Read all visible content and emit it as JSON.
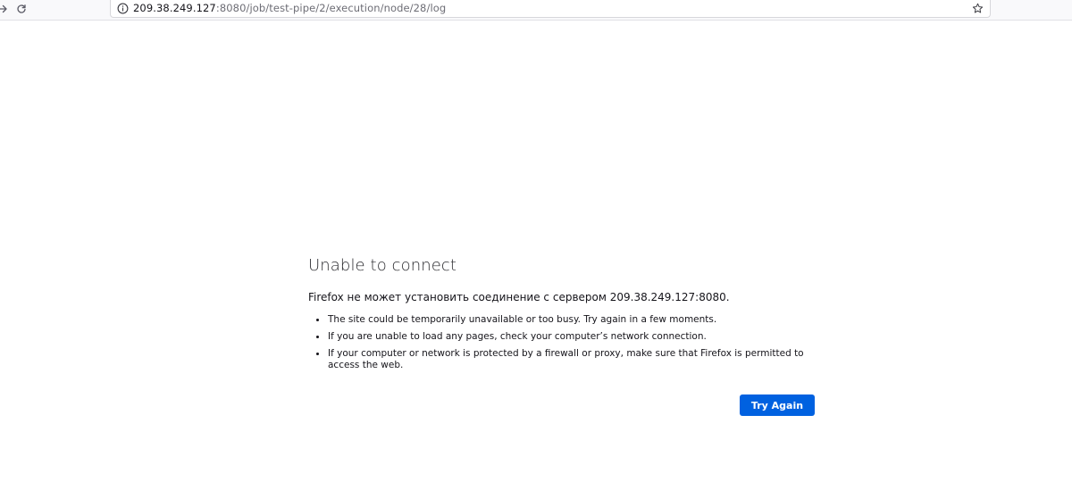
{
  "toolbar": {
    "back_icon": "arrow-right-icon",
    "reload_icon": "reload-icon",
    "url_host": "209.38.249.127",
    "url_path": ":8080/job/test-pipe/2/execution/node/28/log",
    "info_icon": "info-icon",
    "bookmark_icon": "star-icon"
  },
  "error": {
    "title": "Unable to connect",
    "description": "Firefox не может установить соединение с сервером 209.38.249.127:8080.",
    "bullets": [
      "The site could be temporarily unavailable or too busy. Try again in a few moments.",
      "If you are unable to load any pages, check your computer’s network connection.",
      "If your computer or network is protected by a firewall or proxy, make sure that Firefox is permitted to access the web."
    ],
    "try_again_label": "Try Again"
  },
  "colors": {
    "accent": "#0061e0",
    "text": "#15141a",
    "url_path": "#6d6d75"
  }
}
